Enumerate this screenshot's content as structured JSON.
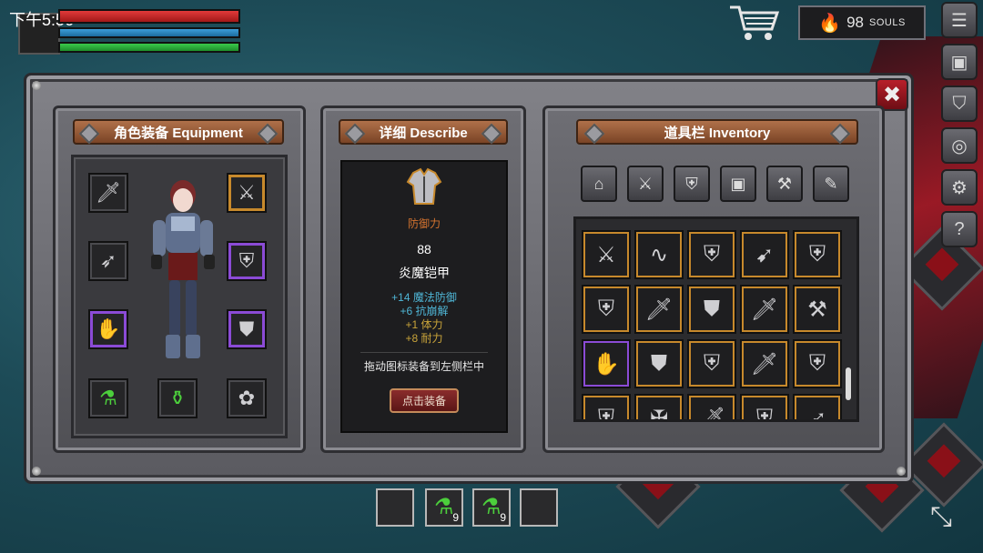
{
  "status_bar": {
    "clock": "下午5:56"
  },
  "player_bars": {
    "hp_fill": 1.0,
    "mp_fill": 1.0,
    "stamina_fill": 1.0
  },
  "souls": {
    "count": "98",
    "label": "SOULS"
  },
  "right_menu": [
    {
      "name": "menu-list-icon",
      "glyph": "☰"
    },
    {
      "name": "backpack-icon",
      "glyph": "▣"
    },
    {
      "name": "helmet-icon",
      "glyph": "⛉"
    },
    {
      "name": "emblem-icon",
      "glyph": "◎"
    },
    {
      "name": "settings-gear-icon",
      "glyph": "⚙"
    },
    {
      "name": "help-icon",
      "glyph": "?"
    }
  ],
  "close_glyph": "✖",
  "equipment": {
    "title": "角色装备 Equipment",
    "slots": [
      {
        "name": "slot-weapon",
        "icon": "sword-icon",
        "glyph": "🗡",
        "frame": ""
      },
      {
        "name": "slot-offhand",
        "icon": "crossed-swords-icon",
        "glyph": "⚔",
        "frame": "gold"
      },
      {
        "name": "slot-quiver",
        "icon": "quiver-icon",
        "glyph": "➶",
        "frame": ""
      },
      {
        "name": "slot-armor",
        "icon": "armor-icon",
        "glyph": "⛨",
        "frame": "purple"
      },
      {
        "name": "slot-gloves",
        "icon": "gauntlet-icon",
        "glyph": "✋",
        "frame": "purple"
      },
      {
        "name": "slot-boots",
        "icon": "greaves-icon",
        "glyph": "⛊",
        "frame": "purple"
      },
      {
        "name": "slot-potion-1",
        "icon": "potion-flask-icon",
        "glyph": "⚗",
        "frame": ""
      },
      {
        "name": "slot-potion-2",
        "icon": "potion-round-icon",
        "glyph": "⚱",
        "frame": ""
      },
      {
        "name": "slot-accessory",
        "icon": "paw-icon",
        "glyph": "✿",
        "frame": ""
      }
    ]
  },
  "describe": {
    "title": "详细 Describe",
    "item_type": "防御力",
    "item_value": "88",
    "item_name": "炎魔铠甲",
    "stats": [
      {
        "text": "+14 魔法防御",
        "color": "#4fb6d6"
      },
      {
        "text": "+6 抗崩解",
        "color": "#4fb6d6"
      },
      {
        "text": "+1 体力",
        "color": "#c9a43a"
      },
      {
        "text": "+8 耐力",
        "color": "#c9a43a"
      }
    ],
    "hint": "拖动图标装备到左侧栏中",
    "equip_button": "点击装备"
  },
  "inventory": {
    "title": "道具栏 Inventory",
    "categories": [
      {
        "name": "category-all-basket-icon",
        "glyph": "⌂"
      },
      {
        "name": "category-weapons-icon",
        "glyph": "⚔"
      },
      {
        "name": "category-armor-icon",
        "glyph": "⛨"
      },
      {
        "name": "category-accessory-icon",
        "glyph": "▣"
      },
      {
        "name": "category-tools-hammer-icon",
        "glyph": "⚒"
      },
      {
        "name": "category-scroll-icon",
        "glyph": "✎"
      }
    ],
    "rows": [
      [
        {
          "icon": "crossed-blades-icon",
          "glyph": "⚔",
          "frame": "gold"
        },
        {
          "icon": "whip-icon",
          "glyph": "∿",
          "frame": "gold"
        },
        {
          "icon": "chest-armor-icon",
          "glyph": "⛨",
          "frame": "gold"
        },
        {
          "icon": "spear-icon",
          "glyph": "➹",
          "frame": "gold"
        },
        {
          "icon": "chest-armor-icon",
          "glyph": "⛨",
          "frame": "gold"
        }
      ],
      [
        {
          "icon": "chest-armor-icon",
          "glyph": "⛨",
          "frame": "gold"
        },
        {
          "icon": "dagger-icon",
          "glyph": "🗡",
          "frame": "gold"
        },
        {
          "icon": "boots-icon",
          "glyph": "⛊",
          "frame": "gold"
        },
        {
          "icon": "sword-icon",
          "glyph": "🗡",
          "frame": "gold"
        },
        {
          "icon": "battle-axe-icon",
          "glyph": "⚒",
          "frame": "gold"
        }
      ],
      [
        {
          "icon": "gauntlet-icon",
          "glyph": "✋",
          "frame": "purple"
        },
        {
          "icon": "boots-icon",
          "glyph": "⛊",
          "frame": "gold"
        },
        {
          "icon": "chest-armor-icon",
          "glyph": "⛨",
          "frame": "gold"
        },
        {
          "icon": "sword-icon",
          "glyph": "🗡",
          "frame": "gold"
        },
        {
          "icon": "chest-armor-icon",
          "glyph": "⛨",
          "frame": "gold"
        }
      ],
      [
        {
          "icon": "chest-armor-icon",
          "glyph": "⛨",
          "frame": "gold"
        },
        {
          "icon": "crossbow-icon",
          "glyph": "✠",
          "frame": "gold"
        },
        {
          "icon": "sword-icon",
          "glyph": "🗡",
          "frame": "gold"
        },
        {
          "icon": "chest-armor-icon",
          "glyph": "⛨",
          "frame": "gold"
        },
        {
          "icon": "spear-icon",
          "glyph": "➹",
          "frame": "gold"
        }
      ]
    ]
  },
  "quickbar": [
    {
      "name": "quickbar-slot-1",
      "count": ""
    },
    {
      "name": "quickbar-slot-2",
      "count": "9"
    },
    {
      "name": "quickbar-slot-3",
      "count": "9"
    },
    {
      "name": "quickbar-slot-4",
      "count": ""
    }
  ],
  "colors": {
    "gold_frame": "#c7892c",
    "purple_frame": "#8b4bd6",
    "banner": "#9a5a36",
    "hp": "#e23a3a",
    "mp": "#3d9ed9",
    "stamina": "#3ac94b"
  }
}
